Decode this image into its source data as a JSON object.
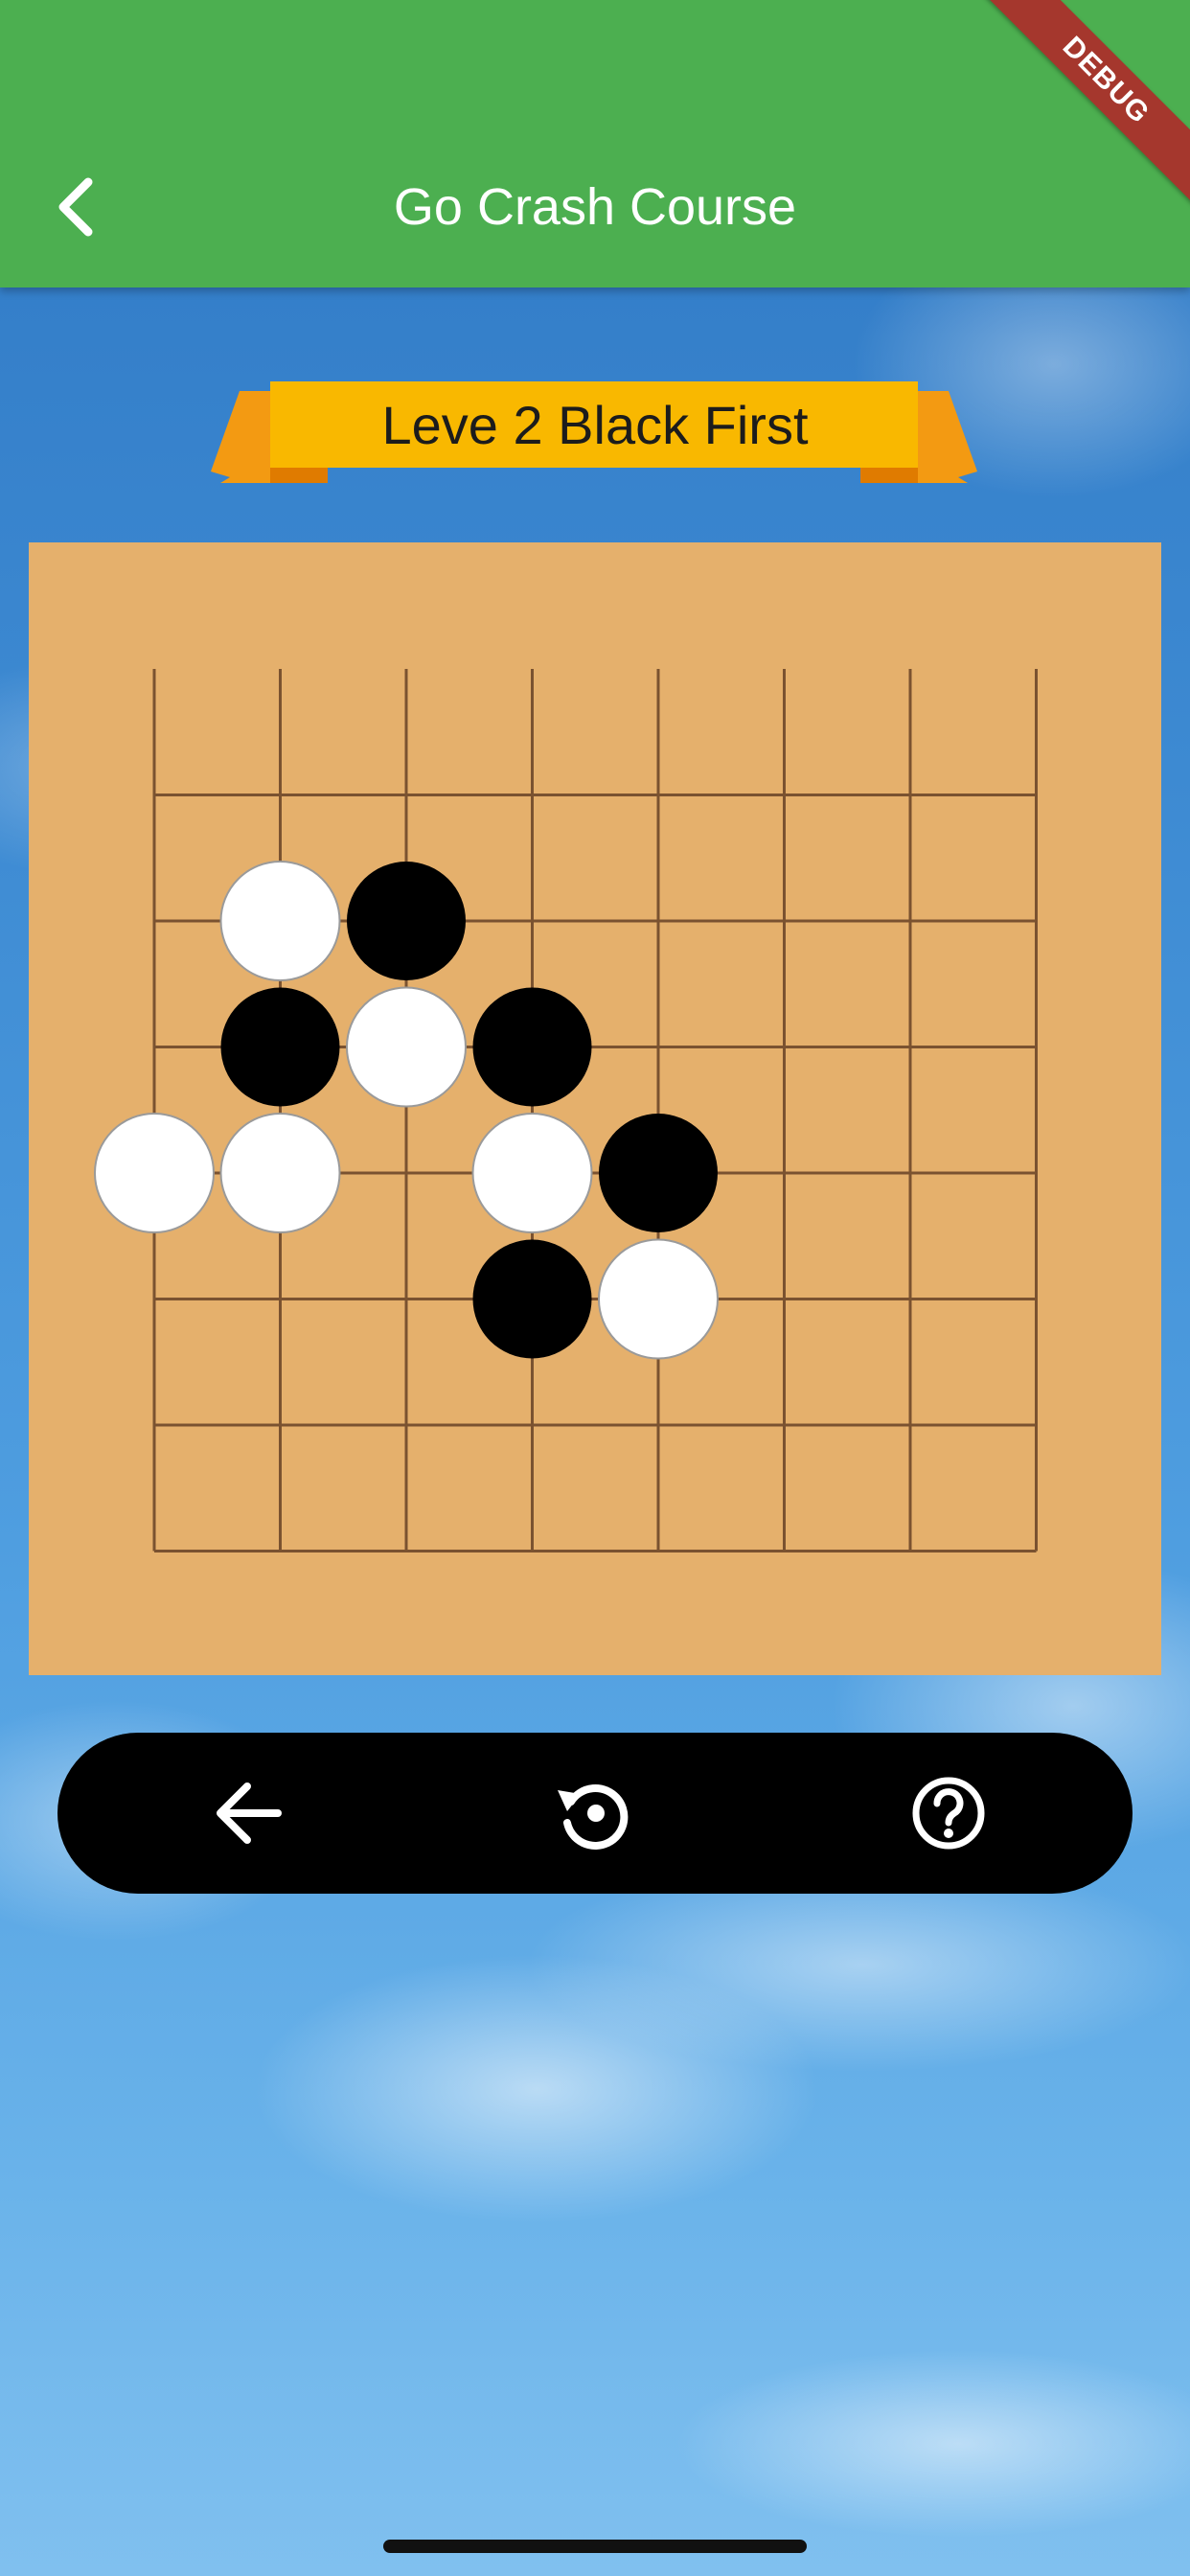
{
  "app_bar": {
    "title": "Go Crash Course",
    "back_icon": "chevron-left-icon",
    "background_color": "#4caf50"
  },
  "debug_banner": {
    "label": "DEBUG"
  },
  "level_banner": {
    "text": "Leve 2 Black First",
    "color": "#f9b800"
  },
  "board": {
    "grid_lines": 8,
    "line_color": "#7a5230",
    "background_color": "#e5b06c",
    "stones": [
      {
        "color": "white",
        "col": 1,
        "row": 2
      },
      {
        "color": "black",
        "col": 2,
        "row": 2
      },
      {
        "color": "black",
        "col": 1,
        "row": 3
      },
      {
        "color": "white",
        "col": 2,
        "row": 3
      },
      {
        "color": "black",
        "col": 3,
        "row": 3
      },
      {
        "color": "white",
        "col": 0,
        "row": 4
      },
      {
        "color": "white",
        "col": 1,
        "row": 4
      },
      {
        "color": "white",
        "col": 3,
        "row": 4
      },
      {
        "color": "black",
        "col": 4,
        "row": 4
      },
      {
        "color": "black",
        "col": 3,
        "row": 5
      },
      {
        "color": "white",
        "col": 4,
        "row": 5
      }
    ]
  },
  "controls": {
    "buttons": [
      {
        "name": "undo-button",
        "icon": "arrow-left-icon"
      },
      {
        "name": "reset-button",
        "icon": "restart-icon"
      },
      {
        "name": "help-button",
        "icon": "help-circle-icon"
      }
    ]
  }
}
